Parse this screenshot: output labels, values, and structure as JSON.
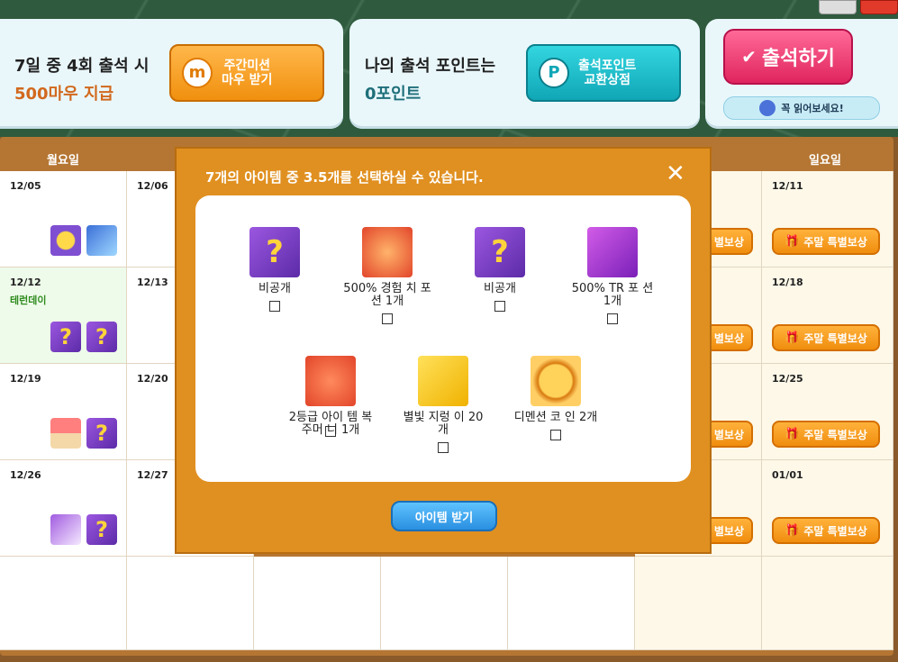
{
  "header": {
    "mission": {
      "line1": "7일 중 4회 출석 시",
      "line2": "500마우 지급",
      "button_line1": "주간미션",
      "button_line2": "마우 받기",
      "badge": "m"
    },
    "points": {
      "line1": "나의 출석 포인트는",
      "line2": "0포인트",
      "button_line1": "출석포인트",
      "button_line2": "교환상점",
      "badge": "P"
    },
    "attend": {
      "button": "출석하기",
      "check": "✔",
      "notice": "꼭 읽어보세요!"
    }
  },
  "calendar": {
    "day_headers": {
      "mon": "월요일",
      "sun": "일요일"
    },
    "dates": {
      "r1": [
        "12/05",
        "12/06",
        "12/11"
      ],
      "r2": [
        "12/12",
        "12/13",
        "12/18"
      ],
      "r3": [
        "12/19",
        "12/20",
        "12/25"
      ],
      "r4": [
        "12/26",
        "12/27",
        "01/01"
      ]
    },
    "holiday": "테런데이",
    "weekend_reward": "주말 특별보상",
    "weekend_reward_partial": "별보상"
  },
  "modal": {
    "title": "7개의 아이템 중 3.5개를 선택하실 수 있습니다.",
    "close": "✕",
    "items": [
      {
        "name": "비공개"
      },
      {
        "name": "500% 경험 치 포션 1개"
      },
      {
        "name": "비공개"
      },
      {
        "name": "500% TR 포 션 1개"
      },
      {
        "name": "2등급 아이 템 복주머 니 1개"
      },
      {
        "name": "별빛 지렁 이 20개"
      },
      {
        "name": "디멘션 코 인 2개"
      }
    ],
    "get_button": "아이템 받기"
  },
  "colors": {
    "accent_orange": "#e09020",
    "attend_pink": "#e8306a",
    "teal": "#1fb6c6"
  }
}
